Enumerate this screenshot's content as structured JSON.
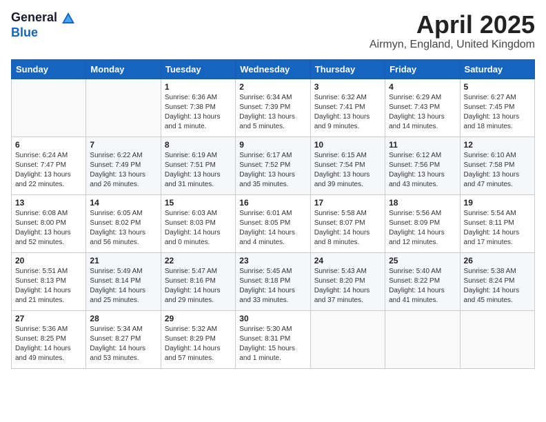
{
  "logo": {
    "general": "General",
    "blue": "Blue"
  },
  "title": "April 2025",
  "subtitle": "Airmyn, England, United Kingdom",
  "weekdays": [
    "Sunday",
    "Monday",
    "Tuesday",
    "Wednesday",
    "Thursday",
    "Friday",
    "Saturday"
  ],
  "weeks": [
    [
      {
        "day": "",
        "sunrise": "",
        "sunset": "",
        "daylight": ""
      },
      {
        "day": "",
        "sunrise": "",
        "sunset": "",
        "daylight": ""
      },
      {
        "day": "1",
        "sunrise": "Sunrise: 6:36 AM",
        "sunset": "Sunset: 7:38 PM",
        "daylight": "Daylight: 13 hours and 1 minute."
      },
      {
        "day": "2",
        "sunrise": "Sunrise: 6:34 AM",
        "sunset": "Sunset: 7:39 PM",
        "daylight": "Daylight: 13 hours and 5 minutes."
      },
      {
        "day": "3",
        "sunrise": "Sunrise: 6:32 AM",
        "sunset": "Sunset: 7:41 PM",
        "daylight": "Daylight: 13 hours and 9 minutes."
      },
      {
        "day": "4",
        "sunrise": "Sunrise: 6:29 AM",
        "sunset": "Sunset: 7:43 PM",
        "daylight": "Daylight: 13 hours and 14 minutes."
      },
      {
        "day": "5",
        "sunrise": "Sunrise: 6:27 AM",
        "sunset": "Sunset: 7:45 PM",
        "daylight": "Daylight: 13 hours and 18 minutes."
      }
    ],
    [
      {
        "day": "6",
        "sunrise": "Sunrise: 6:24 AM",
        "sunset": "Sunset: 7:47 PM",
        "daylight": "Daylight: 13 hours and 22 minutes."
      },
      {
        "day": "7",
        "sunrise": "Sunrise: 6:22 AM",
        "sunset": "Sunset: 7:49 PM",
        "daylight": "Daylight: 13 hours and 26 minutes."
      },
      {
        "day": "8",
        "sunrise": "Sunrise: 6:19 AM",
        "sunset": "Sunset: 7:51 PM",
        "daylight": "Daylight: 13 hours and 31 minutes."
      },
      {
        "day": "9",
        "sunrise": "Sunrise: 6:17 AM",
        "sunset": "Sunset: 7:52 PM",
        "daylight": "Daylight: 13 hours and 35 minutes."
      },
      {
        "day": "10",
        "sunrise": "Sunrise: 6:15 AM",
        "sunset": "Sunset: 7:54 PM",
        "daylight": "Daylight: 13 hours and 39 minutes."
      },
      {
        "day": "11",
        "sunrise": "Sunrise: 6:12 AM",
        "sunset": "Sunset: 7:56 PM",
        "daylight": "Daylight: 13 hours and 43 minutes."
      },
      {
        "day": "12",
        "sunrise": "Sunrise: 6:10 AM",
        "sunset": "Sunset: 7:58 PM",
        "daylight": "Daylight: 13 hours and 47 minutes."
      }
    ],
    [
      {
        "day": "13",
        "sunrise": "Sunrise: 6:08 AM",
        "sunset": "Sunset: 8:00 PM",
        "daylight": "Daylight: 13 hours and 52 minutes."
      },
      {
        "day": "14",
        "sunrise": "Sunrise: 6:05 AM",
        "sunset": "Sunset: 8:02 PM",
        "daylight": "Daylight: 13 hours and 56 minutes."
      },
      {
        "day": "15",
        "sunrise": "Sunrise: 6:03 AM",
        "sunset": "Sunset: 8:03 PM",
        "daylight": "Daylight: 14 hours and 0 minutes."
      },
      {
        "day": "16",
        "sunrise": "Sunrise: 6:01 AM",
        "sunset": "Sunset: 8:05 PM",
        "daylight": "Daylight: 14 hours and 4 minutes."
      },
      {
        "day": "17",
        "sunrise": "Sunrise: 5:58 AM",
        "sunset": "Sunset: 8:07 PM",
        "daylight": "Daylight: 14 hours and 8 minutes."
      },
      {
        "day": "18",
        "sunrise": "Sunrise: 5:56 AM",
        "sunset": "Sunset: 8:09 PM",
        "daylight": "Daylight: 14 hours and 12 minutes."
      },
      {
        "day": "19",
        "sunrise": "Sunrise: 5:54 AM",
        "sunset": "Sunset: 8:11 PM",
        "daylight": "Daylight: 14 hours and 17 minutes."
      }
    ],
    [
      {
        "day": "20",
        "sunrise": "Sunrise: 5:51 AM",
        "sunset": "Sunset: 8:13 PM",
        "daylight": "Daylight: 14 hours and 21 minutes."
      },
      {
        "day": "21",
        "sunrise": "Sunrise: 5:49 AM",
        "sunset": "Sunset: 8:14 PM",
        "daylight": "Daylight: 14 hours and 25 minutes."
      },
      {
        "day": "22",
        "sunrise": "Sunrise: 5:47 AM",
        "sunset": "Sunset: 8:16 PM",
        "daylight": "Daylight: 14 hours and 29 minutes."
      },
      {
        "day": "23",
        "sunrise": "Sunrise: 5:45 AM",
        "sunset": "Sunset: 8:18 PM",
        "daylight": "Daylight: 14 hours and 33 minutes."
      },
      {
        "day": "24",
        "sunrise": "Sunrise: 5:43 AM",
        "sunset": "Sunset: 8:20 PM",
        "daylight": "Daylight: 14 hours and 37 minutes."
      },
      {
        "day": "25",
        "sunrise": "Sunrise: 5:40 AM",
        "sunset": "Sunset: 8:22 PM",
        "daylight": "Daylight: 14 hours and 41 minutes."
      },
      {
        "day": "26",
        "sunrise": "Sunrise: 5:38 AM",
        "sunset": "Sunset: 8:24 PM",
        "daylight": "Daylight: 14 hours and 45 minutes."
      }
    ],
    [
      {
        "day": "27",
        "sunrise": "Sunrise: 5:36 AM",
        "sunset": "Sunset: 8:25 PM",
        "daylight": "Daylight: 14 hours and 49 minutes."
      },
      {
        "day": "28",
        "sunrise": "Sunrise: 5:34 AM",
        "sunset": "Sunset: 8:27 PM",
        "daylight": "Daylight: 14 hours and 53 minutes."
      },
      {
        "day": "29",
        "sunrise": "Sunrise: 5:32 AM",
        "sunset": "Sunset: 8:29 PM",
        "daylight": "Daylight: 14 hours and 57 minutes."
      },
      {
        "day": "30",
        "sunrise": "Sunrise: 5:30 AM",
        "sunset": "Sunset: 8:31 PM",
        "daylight": "Daylight: 15 hours and 1 minute."
      },
      {
        "day": "",
        "sunrise": "",
        "sunset": "",
        "daylight": ""
      },
      {
        "day": "",
        "sunrise": "",
        "sunset": "",
        "daylight": ""
      },
      {
        "day": "",
        "sunrise": "",
        "sunset": "",
        "daylight": ""
      }
    ]
  ]
}
